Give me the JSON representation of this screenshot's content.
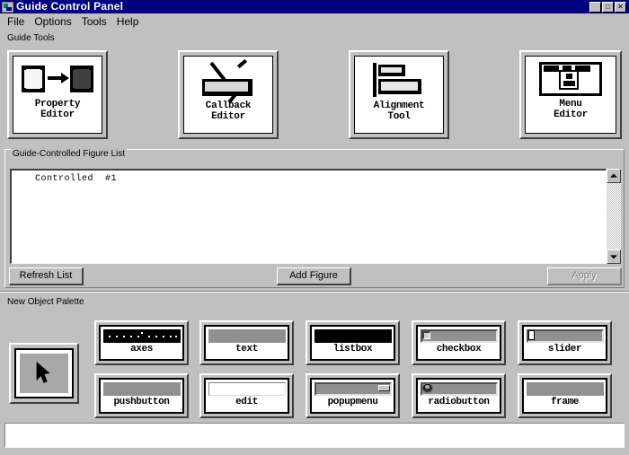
{
  "window": {
    "title": "Guide Control Panel",
    "sysicon": "app-system-icon",
    "buttons": {
      "minimize": "_",
      "maximize": "□",
      "close": "✕"
    }
  },
  "menubar": {
    "items": [
      {
        "label": "File"
      },
      {
        "label": "Options"
      },
      {
        "label": "Tools"
      },
      {
        "label": "Help"
      }
    ]
  },
  "guide_tools": {
    "label": "Guide Tools",
    "buttons": [
      {
        "name": "property-editor",
        "line1": "Property",
        "line2": "Editor",
        "icon": "property-editor-icon"
      },
      {
        "name": "callback-editor",
        "line1": "Callback",
        "line2": "Editor",
        "icon": "callback-editor-icon"
      },
      {
        "name": "alignment-tool",
        "line1": "Alignment",
        "line2": "Tool",
        "icon": "alignment-tool-icon"
      },
      {
        "name": "menu-editor",
        "line1": "Menu",
        "line2": "Editor",
        "icon": "menu-editor-icon"
      }
    ]
  },
  "figure_list": {
    "group_label": "Guide-Controlled Figure List",
    "items": [
      {
        "text": "Controlled  #1"
      }
    ],
    "scrollbar": {
      "up": "scroll-up-arrow",
      "down": "scroll-down-arrow"
    }
  },
  "actions": {
    "refresh_list": "Refresh List",
    "add_figure": "Add Figure",
    "apply": "Apply",
    "apply_enabled": false
  },
  "palette": {
    "label": "New Object Palette",
    "select_tool": {
      "name": "select-arrow-tool",
      "icon": "arrow-cursor-icon",
      "selected": true
    },
    "items": [
      {
        "label": "axes",
        "glyph": "axes-glyph"
      },
      {
        "label": "text",
        "glyph": "text-glyph"
      },
      {
        "label": "listbox",
        "glyph": "listbox-glyph"
      },
      {
        "label": "checkbox",
        "glyph": "checkbox-glyph"
      },
      {
        "label": "slider",
        "glyph": "slider-glyph"
      },
      {
        "label": "pushbutton",
        "glyph": "pushbutton-glyph"
      },
      {
        "label": "edit",
        "glyph": "edit-glyph"
      },
      {
        "label": "popupmenu",
        "glyph": "popupmenu-glyph"
      },
      {
        "label": "radiobutton",
        "glyph": "radiobutton-glyph"
      },
      {
        "label": "frame",
        "glyph": "frame-glyph"
      }
    ]
  },
  "statusbar": {
    "text": ""
  },
  "colors": {
    "titlebar": "#000080",
    "face": "#c0c0c0",
    "shadow": "#808080",
    "dark": "#404040",
    "light": "#ffffff",
    "window": "#ffffff"
  }
}
